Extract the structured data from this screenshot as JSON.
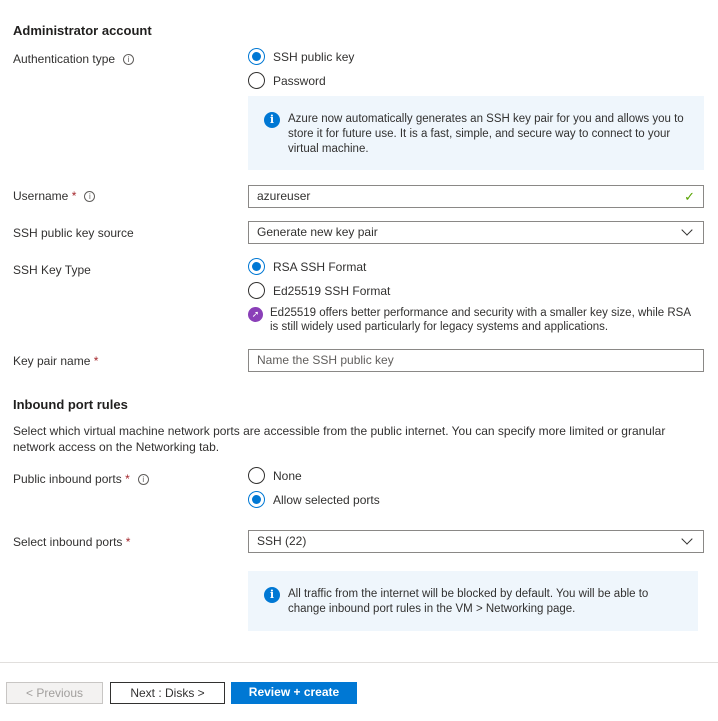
{
  "admin": {
    "heading": "Administrator account",
    "auth_label": "Authentication type",
    "auth_options": [
      "SSH public key",
      "Password"
    ],
    "auth_selected": "SSH public key",
    "auth_info": "Azure now automatically generates an SSH key pair for you and allows you to store it for future use. It is a fast, simple, and secure way to connect to your virtual machine.",
    "username_label": "Username",
    "username_value": "azureuser",
    "source_label": "SSH public key source",
    "source_value": "Generate new key pair",
    "keytype_label": "SSH Key Type",
    "keytype_options": [
      "RSA SSH Format",
      "Ed25519 SSH Format"
    ],
    "keytype_selected": "RSA SSH Format",
    "keytype_note": "Ed25519 offers better performance and security with a smaller key size, while RSA is still widely used particularly for legacy systems and applications.",
    "keypair_label": "Key pair name",
    "keypair_placeholder": "Name the SSH public key"
  },
  "inbound": {
    "heading": "Inbound port rules",
    "description": "Select which virtual machine network ports are accessible from the public internet. You can specify more limited or granular network access on the Networking tab.",
    "public_label": "Public inbound ports",
    "public_options": [
      "None",
      "Allow selected ports"
    ],
    "public_selected": "Allow selected ports",
    "select_label": "Select inbound ports",
    "select_value": "SSH (22)",
    "info": "All traffic from the internet will be blocked by default. You will be able to change inbound port rules in the VM > Networking page."
  },
  "footer": {
    "previous": "< Previous",
    "next": "Next : Disks >",
    "review": "Review + create"
  },
  "required_mark": "*",
  "info_glyph": "i",
  "colors": {
    "accent": "#0078d4",
    "info_bg": "#eff6fc",
    "rocket": "#8a3fb8",
    "success": "#57a300"
  }
}
